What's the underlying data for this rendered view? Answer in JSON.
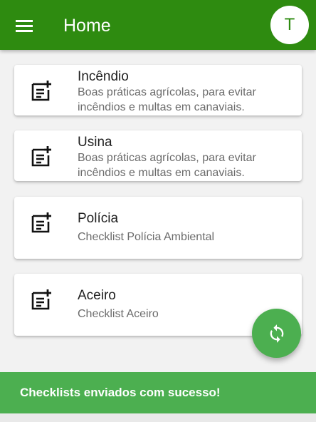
{
  "appbar": {
    "title": "Home",
    "avatar_letter": "T",
    "color": "#2e8b10"
  },
  "cards": [
    {
      "title": "Incêndio",
      "subtitle": "Boas práticas agrícolas, para evitar incêndios e multas em canaviais.",
      "icon": "note-add-icon"
    },
    {
      "title": "Usina",
      "subtitle": "Boas práticas agrícolas, para evitar incêndios e multas em canaviais.",
      "icon": "note-add-icon"
    },
    {
      "title": "Polícia",
      "subtitle": "Checklist Polícia Ambiental",
      "icon": "note-add-icon"
    },
    {
      "title": "Aceiro",
      "subtitle": "Checklist Aceiro",
      "icon": "note-add-icon"
    }
  ],
  "fab": {
    "icon": "sync-icon",
    "color": "#4caf50"
  },
  "snackbar": {
    "message": "Checklists enviados com sucesso!"
  }
}
